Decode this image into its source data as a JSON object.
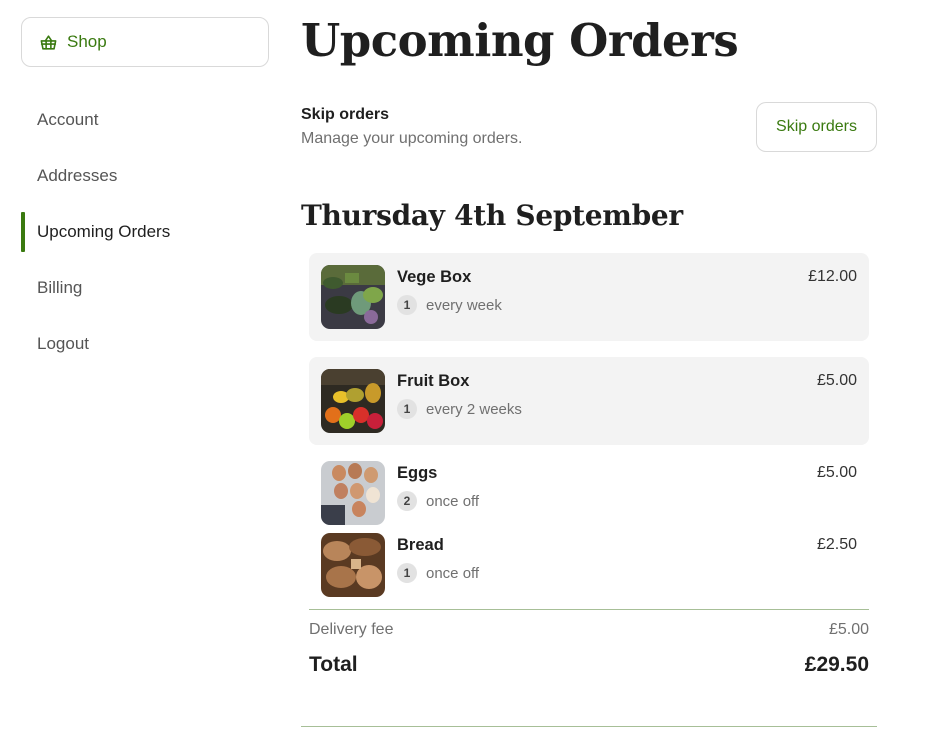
{
  "sidebar": {
    "shop_label": "Shop",
    "items": [
      {
        "label": "Account",
        "active": false
      },
      {
        "label": "Addresses",
        "active": false
      },
      {
        "label": "Upcoming Orders",
        "active": true
      },
      {
        "label": "Billing",
        "active": false
      },
      {
        "label": "Logout",
        "active": false
      }
    ]
  },
  "main": {
    "title": "Upcoming Orders",
    "skip": {
      "heading": "Skip orders",
      "description": "Manage your upcoming orders.",
      "button_label": "Skip orders"
    },
    "orders": [
      {
        "date": "Thursday 4th September",
        "items": [
          {
            "name": "Vege Box",
            "qty": "1",
            "frequency": "every week",
            "price": "£12.00",
            "thumbnail": "vegetable-box-photo"
          },
          {
            "name": "Fruit Box",
            "qty": "1",
            "frequency": "every 2 weeks",
            "price": "£5.00",
            "thumbnail": "fruit-box-photo"
          },
          {
            "name": "Eggs",
            "qty": "2",
            "frequency": "once off",
            "price": "£5.00",
            "thumbnail": "eggs-photo"
          },
          {
            "name": "Bread",
            "qty": "1",
            "frequency": "once off",
            "price": "£2.50",
            "thumbnail": "bread-photo"
          }
        ],
        "delivery_fee_label": "Delivery fee",
        "delivery_fee": "£5.00",
        "total_label": "Total",
        "total": "£29.50"
      }
    ]
  },
  "colors": {
    "accent": "#3a7a10",
    "divider": "#a7bf97",
    "subscription_bg": "#f3f3f3"
  },
  "icons": {
    "shop": "basket-icon"
  }
}
